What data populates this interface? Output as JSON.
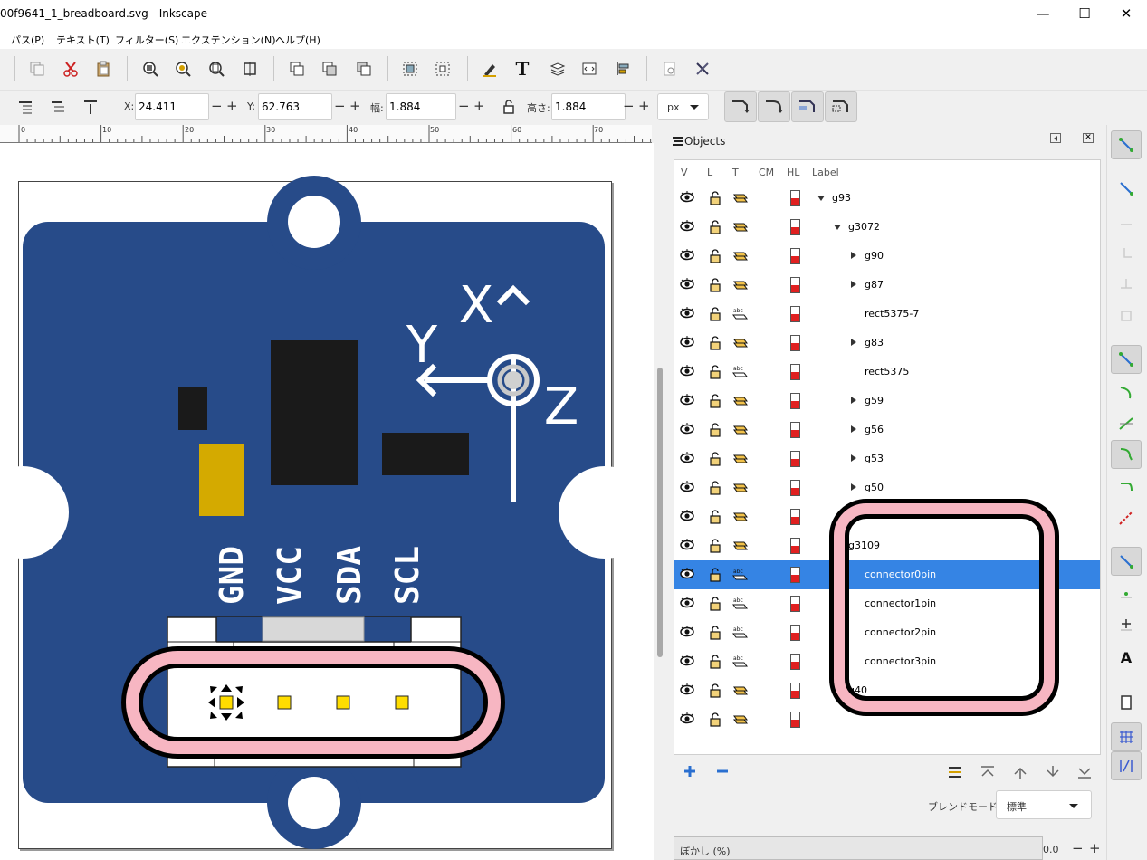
{
  "window": {
    "title": "00f9641_1_breadboard.svg - Inkscape",
    "minimize": "—",
    "maximize": "☐",
    "close": "✕"
  },
  "menu": [
    "パス(P)",
    "テキスト(T)",
    "フィルター(S)",
    "エクステンション(N)",
    "ヘルプ(H)"
  ],
  "toolbar": {
    "x_label": "X:",
    "x_value": "24.411",
    "y_label": "Y:",
    "y_value": "62.763",
    "w_label": "幅:",
    "w_value": "1.884",
    "h_label": "高さ:",
    "h_value": "1.884",
    "unit": "px",
    "minus": "−",
    "plus": "+"
  },
  "ruler": {
    "labels": [
      "0",
      "10",
      "20",
      "30",
      "40",
      "50",
      "60",
      "70"
    ]
  },
  "canvas": {
    "board_color": "#274b89",
    "pin_labels": [
      "GND",
      "VCC",
      "SDA",
      "SCL"
    ],
    "axis_labels": [
      "X",
      "Y",
      "Z"
    ],
    "accent_gold": "#d4aa00",
    "pin_color": "#ffdd00",
    "highlight_color": "#f7b6c2"
  },
  "panel": {
    "title": "Objects",
    "columns": [
      "V",
      "L",
      "T",
      "CM",
      "HL",
      "Label"
    ],
    "rows": [
      {
        "label": "g93",
        "depth": 0,
        "expander": "open",
        "type": "group",
        "selected": false
      },
      {
        "label": "g3072",
        "depth": 1,
        "expander": "open",
        "type": "group",
        "selected": false
      },
      {
        "label": "g90",
        "depth": 2,
        "expander": "closed",
        "type": "group",
        "selected": false
      },
      {
        "label": "g87",
        "depth": 2,
        "expander": "closed",
        "type": "group",
        "selected": false
      },
      {
        "label": "rect5375-7",
        "depth": 2,
        "expander": "none",
        "type": "text",
        "selected": false
      },
      {
        "label": "g83",
        "depth": 2,
        "expander": "closed",
        "type": "group",
        "selected": false
      },
      {
        "label": "rect5375",
        "depth": 2,
        "expander": "none",
        "type": "text",
        "selected": false
      },
      {
        "label": "g59",
        "depth": 2,
        "expander": "closed",
        "type": "group",
        "selected": false
      },
      {
        "label": "g56",
        "depth": 2,
        "expander": "closed",
        "type": "group",
        "selected": false
      },
      {
        "label": "g53",
        "depth": 2,
        "expander": "closed",
        "type": "group",
        "selected": false
      },
      {
        "label": "g50",
        "depth": 2,
        "expander": "closed",
        "type": "group",
        "selected": false
      },
      {
        "label": "",
        "depth": 2,
        "expander": "none",
        "type": "group",
        "selected": false
      },
      {
        "label": "g3109",
        "depth": 1,
        "expander": "open",
        "type": "group",
        "selected": false
      },
      {
        "label": "connector0pin",
        "depth": 2,
        "expander": "none",
        "type": "text",
        "selected": true
      },
      {
        "label": "connector1pin",
        "depth": 2,
        "expander": "none",
        "type": "text",
        "selected": false
      },
      {
        "label": "connector2pin",
        "depth": 2,
        "expander": "none",
        "type": "text",
        "selected": false
      },
      {
        "label": "connector3pin",
        "depth": 2,
        "expander": "none",
        "type": "text",
        "selected": false
      },
      {
        "label": "g40",
        "depth": 1,
        "expander": "closed",
        "type": "group",
        "selected": false
      },
      {
        "label": "",
        "depth": 1,
        "expander": "none",
        "type": "group",
        "selected": false
      }
    ],
    "blend_label": "ブレンドモード:",
    "blend_value": "標準",
    "blur_label": "ぼかし (%)",
    "blur_value": "0.0",
    "blur_minus": "−",
    "blur_plus": "+"
  }
}
